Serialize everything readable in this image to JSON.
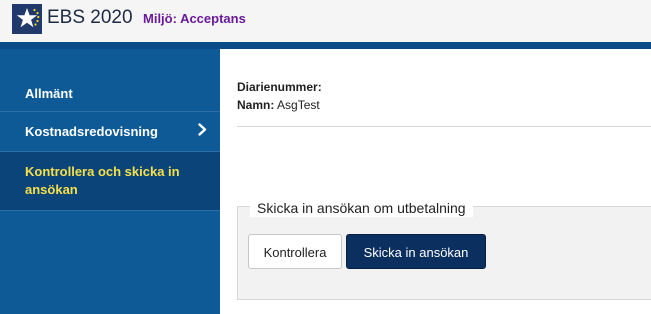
{
  "header": {
    "logo_icon": "star-logo-icon",
    "app_title": "EBS 2020",
    "environment": "Miljö: Acceptans",
    "colors": {
      "header_bar": "#0a4a86",
      "environment_text": "#6a1b9a"
    }
  },
  "sidebar": {
    "background": "#0d5a97",
    "items": [
      {
        "label": "Allmänt",
        "active": false
      },
      {
        "label": "Kostnadsredovisning",
        "active": false,
        "icon": "chevron-right-icon"
      },
      {
        "label": "Kontrollera och skicka in ansökan",
        "active": true
      }
    ],
    "active_text_color": "#f6e04a"
  },
  "main": {
    "info": {
      "diarienummer_label": "Diarienummer:",
      "diarienummer_value": "",
      "namn_label": "Namn:",
      "namn_value": "AsgTest"
    },
    "submit_section": {
      "legend": "Skicka in ansökan om utbetalning",
      "kontrollera_label": "Kontrollera",
      "skicka_label": "Skicka in ansökan",
      "primary_color": "#0b2f5f"
    }
  }
}
